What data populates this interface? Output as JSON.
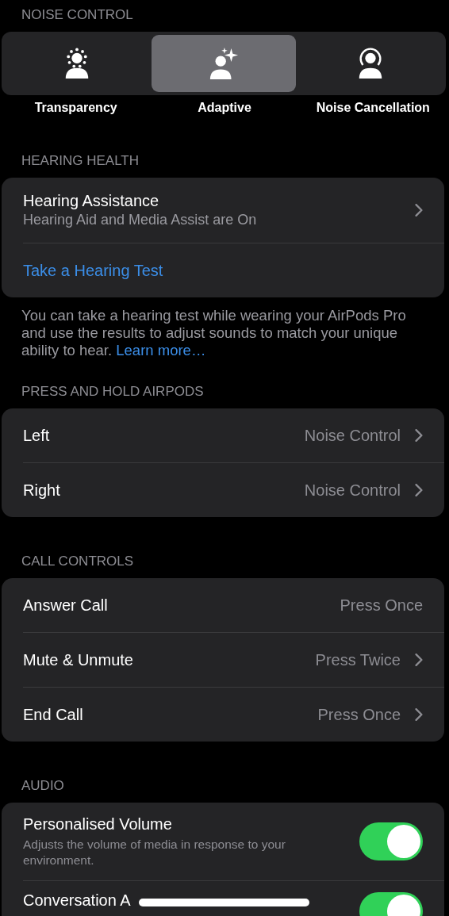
{
  "noise_control": {
    "header": "NOISE CONTROL",
    "modes": [
      {
        "label": "Transparency",
        "kind": "transparency",
        "selected": false
      },
      {
        "label": "Adaptive",
        "kind": "adaptive",
        "selected": true
      },
      {
        "label": "Noise Cancellation",
        "kind": "cancellation",
        "selected": false
      }
    ]
  },
  "hearing_health": {
    "header": "HEARING HEALTH",
    "assistance": {
      "title": "Hearing Assistance",
      "subtitle": "Hearing Aid and Media Assist are On"
    },
    "test_link": "Take a Hearing Test",
    "footer": "You can take a hearing test while wearing your AirPods Pro and use the results to adjust sounds to match your unique ability to hear.",
    "footer_link": "Learn more…"
  },
  "press_and_hold": {
    "header": "PRESS AND HOLD AIRPODS",
    "rows": [
      {
        "label": "Left",
        "value": "Noise Control",
        "chevron": true
      },
      {
        "label": "Right",
        "value": "Noise Control",
        "chevron": true
      }
    ]
  },
  "call_controls": {
    "header": "CALL CONTROLS",
    "rows": [
      {
        "label": "Answer Call",
        "value": "Press Once",
        "chevron": false
      },
      {
        "label": "Mute & Unmute",
        "value": "Press Twice",
        "chevron": true
      },
      {
        "label": "End Call",
        "value": "Press Once",
        "chevron": true
      }
    ]
  },
  "audio": {
    "header": "AUDIO",
    "rows": [
      {
        "label": "Personalised Volume",
        "description": "Adjusts the volume of media in response to your environment.",
        "on": true
      },
      {
        "label": "Conversation A",
        "on": true
      }
    ]
  }
}
